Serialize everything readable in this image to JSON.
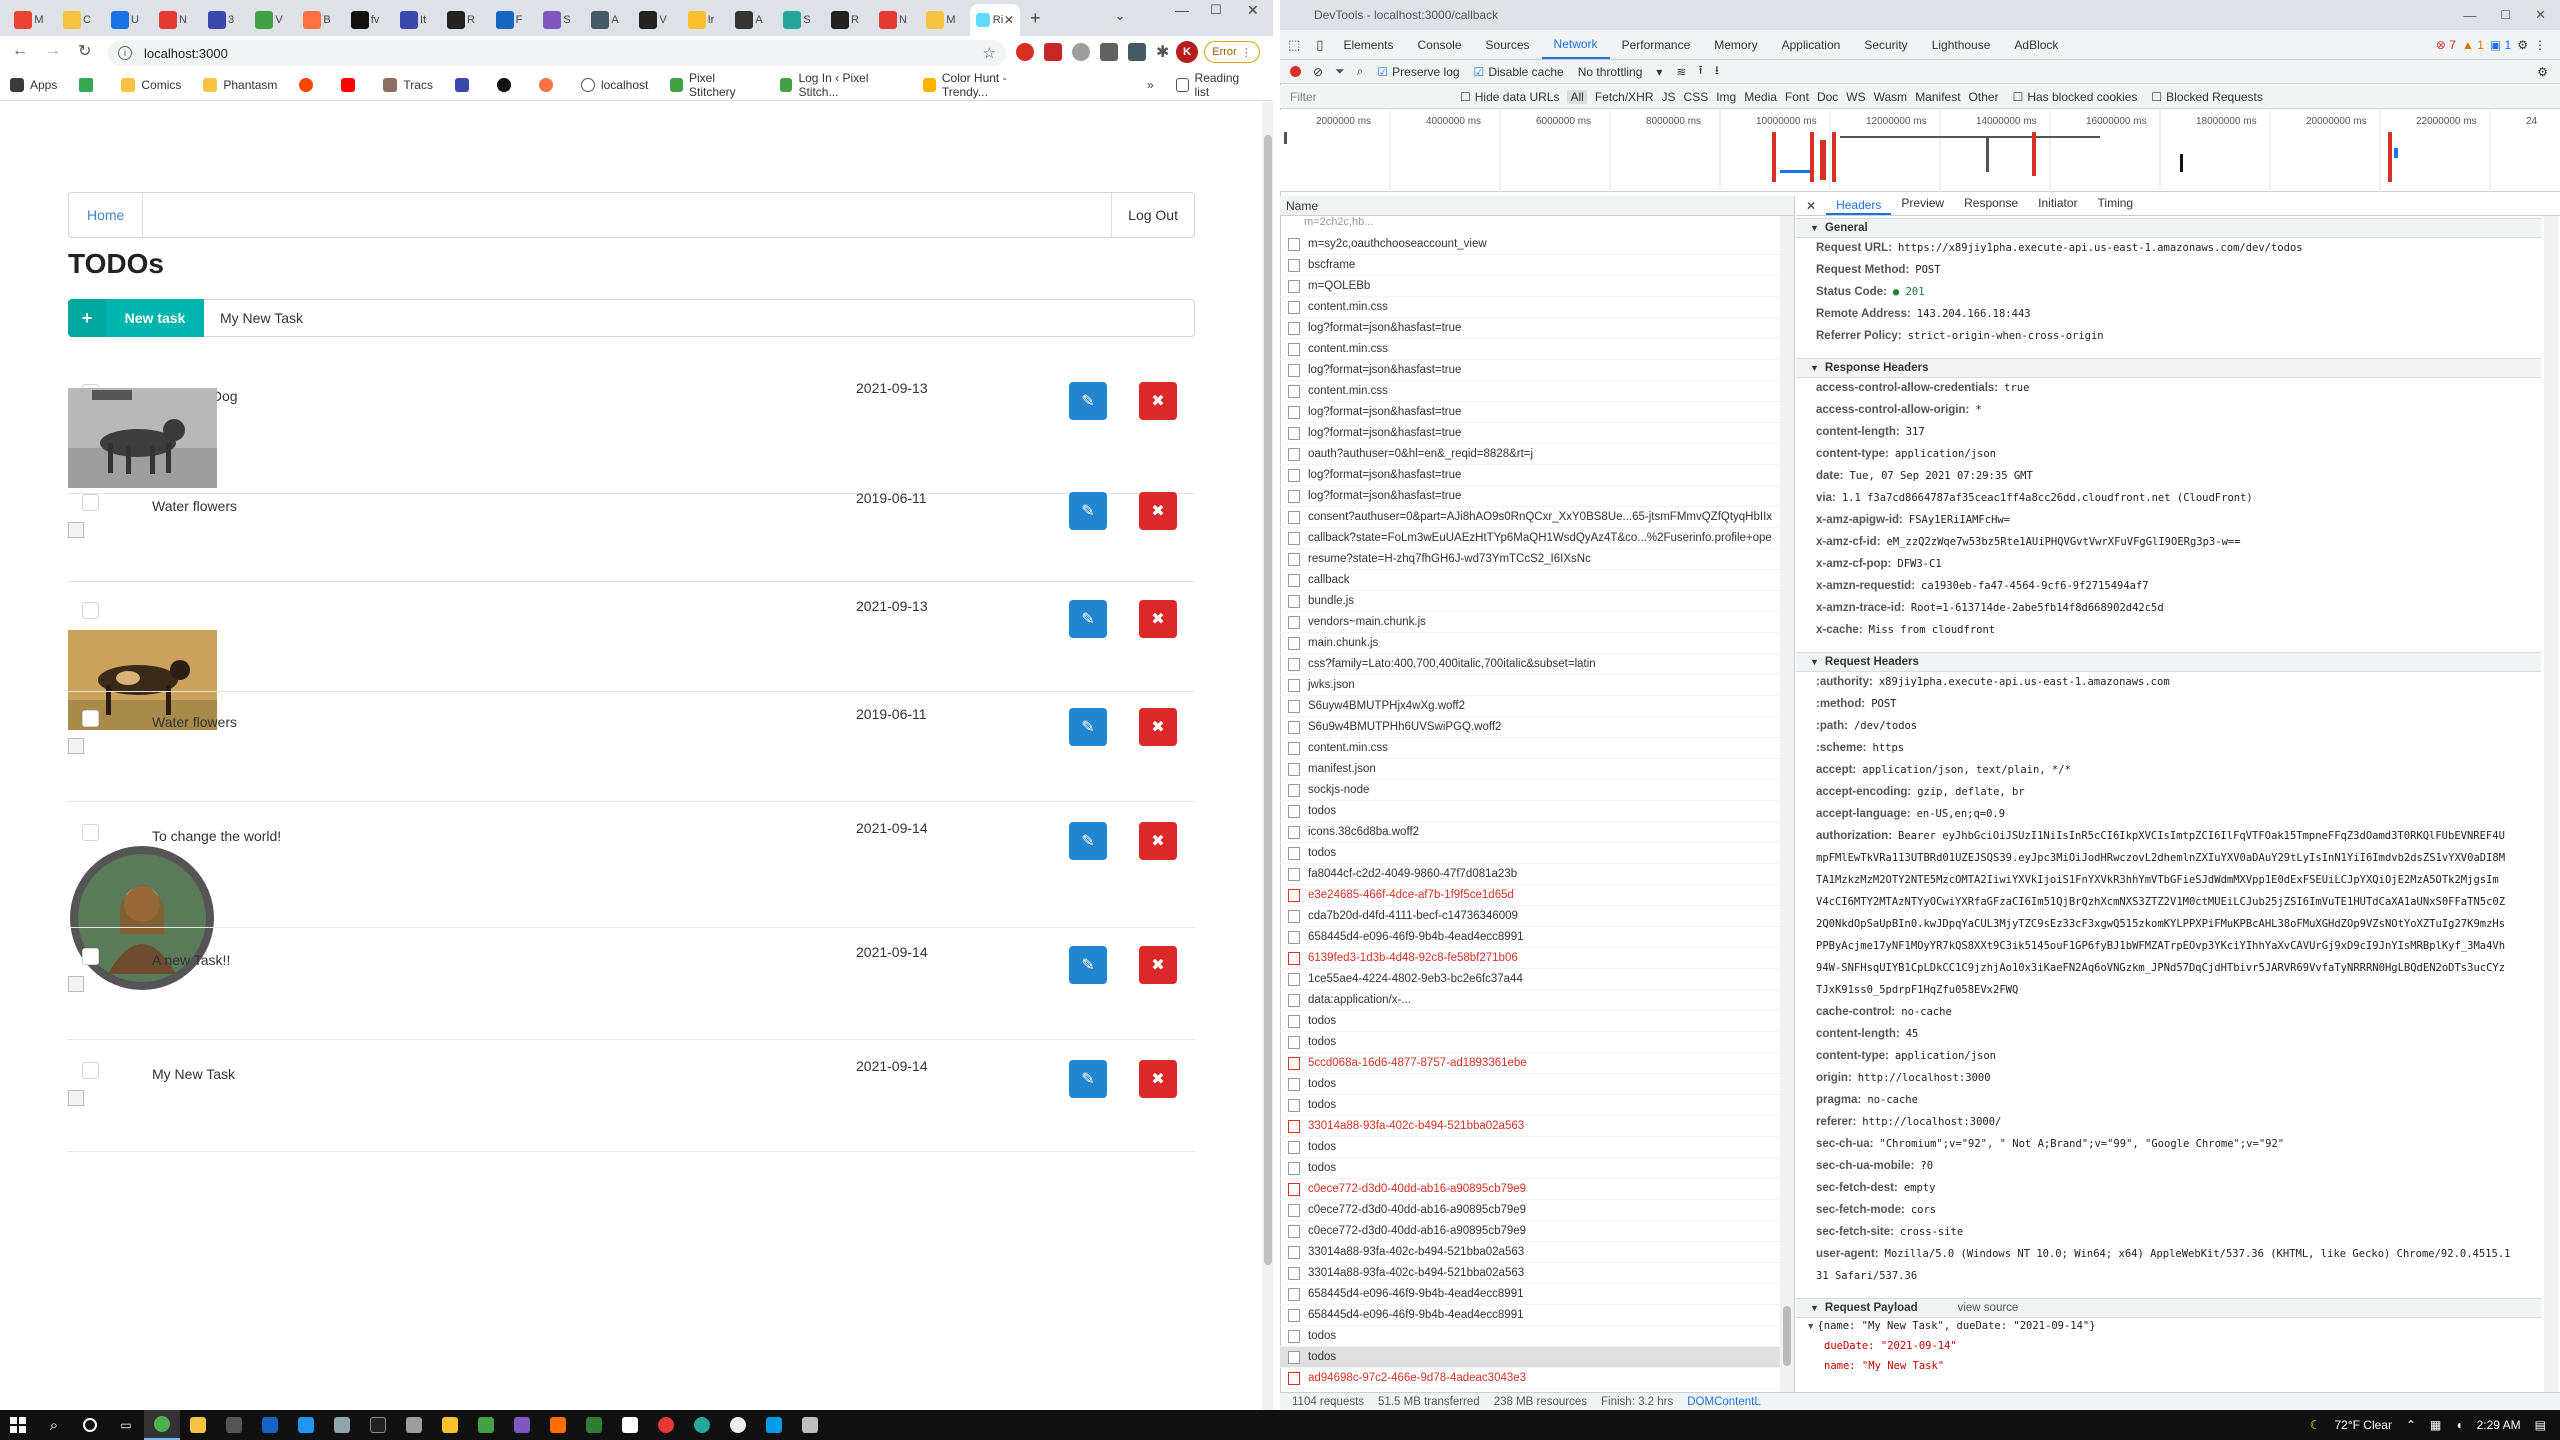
{
  "colors": {
    "accent": "#1a73e8",
    "teal": "#00b5ad",
    "blue": "#2185d0",
    "red": "#db2828",
    "link": "#4183c4"
  },
  "browser": {
    "tabs": [
      "M",
      "C",
      "U",
      "N",
      "3",
      "V",
      "B",
      "fv",
      "It",
      "R",
      "F",
      "S",
      "A",
      "V",
      "Ir",
      "A",
      "S",
      "R",
      "N",
      "M",
      "Ri"
    ],
    "url": "localhost:3000",
    "profile": "K",
    "error_chip": "Error",
    "bookmarks": [
      "Apps",
      "Comics",
      "Phantasm",
      "Tracs",
      "localhost",
      "Pixel Stitchery",
      "Log In ‹ Pixel Stitch...",
      "Color Hunt - Trendy..."
    ],
    "reading_list": "Reading list"
  },
  "app": {
    "nav_home": "Home",
    "nav_logout": "Log Out",
    "title": "TODOs",
    "new_task_label": "New task",
    "new_task_value": "My New Task",
    "todos": [
      {
        "name": "Play with Dog",
        "date": "2021-09-13",
        "done": true,
        "image": "wolf"
      },
      {
        "name": "Water flowers",
        "date": "2019-06-11",
        "done": false,
        "image": "broken"
      },
      {
        "name": "",
        "date": "2021-09-13",
        "done": false,
        "image": "wild-dog"
      },
      {
        "name": "Water flowers",
        "date": "2019-06-11",
        "done": false,
        "image": "broken"
      },
      {
        "name": "To change the world!",
        "date": "2021-09-14",
        "done": false,
        "image": "portrait"
      },
      {
        "name": "A new Task!!",
        "date": "2021-09-14",
        "done": false,
        "image": "broken"
      },
      {
        "name": "My New Task",
        "date": "2021-09-14",
        "done": false,
        "image": "broken"
      }
    ]
  },
  "devtools": {
    "title": "DevTools - localhost:3000/callback",
    "panels": [
      "Elements",
      "Console",
      "Sources",
      "Network",
      "Performance",
      "Memory",
      "Application",
      "Security",
      "Lighthouse",
      "AdBlock"
    ],
    "active_panel": "Network",
    "issues": {
      "errors": "7",
      "warnings": "1",
      "info": "1"
    },
    "preserve_log": "Preserve log",
    "disable_cache": "Disable cache",
    "throttling": "No throttling",
    "filter_placeholder": "Filter",
    "hide_data_urls": "Hide data URLs",
    "type_filters": [
      "All",
      "Fetch/XHR",
      "JS",
      "CSS",
      "Img",
      "Media",
      "Font",
      "Doc",
      "WS",
      "Wasm",
      "Manifest",
      "Other"
    ],
    "has_blocked_cookies": "Has blocked cookies",
    "blocked_requests": "Blocked Requests",
    "timeline_ticks": [
      "2000000 ms",
      "4000000 ms",
      "6000000 ms",
      "8000000 ms",
      "10000000 ms",
      "12000000 ms",
      "14000000 ms",
      "16000000 ms",
      "18000000 ms",
      "20000000 ms",
      "22000000 ms",
      "24"
    ],
    "name_header": "Name",
    "requests": [
      {
        "n": "m=sy2c,oauthchooseaccount_view",
        "e": false
      },
      {
        "n": "bscframe",
        "e": false
      },
      {
        "n": "m=QOLEBb",
        "e": false
      },
      {
        "n": "content.min.css",
        "e": false
      },
      {
        "n": "log?format=json&hasfast=true",
        "e": false
      },
      {
        "n": "content.min.css",
        "e": false
      },
      {
        "n": "log?format=json&hasfast=true",
        "e": false
      },
      {
        "n": "content.min.css",
        "e": false
      },
      {
        "n": "log?format=json&hasfast=true",
        "e": false
      },
      {
        "n": "log?format=json&hasfast=true",
        "e": false
      },
      {
        "n": "oauth?authuser=0&hl=en&_reqid=8828&rt=j",
        "e": false
      },
      {
        "n": "log?format=json&hasfast=true",
        "e": false
      },
      {
        "n": "log?format=json&hasfast=true",
        "e": false
      },
      {
        "n": "consent?authuser=0&part=AJi8hAO9s0RnQCxr_XxY0BS8Ue...65-jtsmFMmvQZfQtyqHbIIx",
        "e": false
      },
      {
        "n": "callback?state=FoLm3wEuUAEzHtTYp6MaQH1WsdQyAz4T&co...%2Fuserinfo.profile+ope",
        "e": false
      },
      {
        "n": "resume?state=H-zhq7fhGH6J-wd73YmTCcS2_I6IXsNc",
        "e": false
      },
      {
        "n": "callback",
        "e": false
      },
      {
        "n": "bundle.js",
        "e": false
      },
      {
        "n": "vendors~main.chunk.js",
        "e": false
      },
      {
        "n": "main.chunk.js",
        "e": false
      },
      {
        "n": "css?family=Lato:400,700,400italic,700italic&subset=latin",
        "e": false
      },
      {
        "n": "jwks.json",
        "e": false
      },
      {
        "n": "S6uyw4BMUTPHjx4wXg.woff2",
        "e": false
      },
      {
        "n": "S6u9w4BMUTPHh6UVSwiPGQ.woff2",
        "e": false
      },
      {
        "n": "content.min.css",
        "e": false
      },
      {
        "n": "manifest.json",
        "e": false
      },
      {
        "n": "sockjs-node",
        "e": false
      },
      {
        "n": "todos",
        "e": false
      },
      {
        "n": "icons.38c6d8ba.woff2",
        "e": false
      },
      {
        "n": "todos",
        "e": false
      },
      {
        "n": "fa8044cf-c2d2-4049-9860-47f7d081a23b",
        "e": false
      },
      {
        "n": "e3e24685-466f-4dce-af7b-1f9f5ce1d65d",
        "e": true
      },
      {
        "n": "cda7b20d-d4fd-4111-becf-c14736346009",
        "e": false
      },
      {
        "n": "658445d4-e096-46f9-9b4b-4ead4ecc8991",
        "e": false
      },
      {
        "n": "6139fed3-1d3b-4d48-92c8-fe58bf271b06",
        "e": true
      },
      {
        "n": "1ce55ae4-4224-4802-9eb3-bc2e6fc37a44",
        "e": false
      },
      {
        "n": "data:application/x-...",
        "e": false
      },
      {
        "n": "todos",
        "e": false
      },
      {
        "n": "todos",
        "e": false
      },
      {
        "n": "5ccd068a-16d6-4877-8757-ad1893361ebe",
        "e": true
      },
      {
        "n": "todos",
        "e": false
      },
      {
        "n": "todos",
        "e": false
      },
      {
        "n": "33014a88-93fa-402c-b494-521bba02a563",
        "e": true
      },
      {
        "n": "todos",
        "e": false
      },
      {
        "n": "todos",
        "e": false
      },
      {
        "n": "c0ece772-d3d0-40dd-ab16-a90895cb79e9",
        "e": true
      },
      {
        "n": "c0ece772-d3d0-40dd-ab16-a90895cb79e9",
        "e": false
      },
      {
        "n": "c0ece772-d3d0-40dd-ab16-a90895cb79e9",
        "e": false
      },
      {
        "n": "33014a88-93fa-402c-b494-521bba02a563",
        "e": false
      },
      {
        "n": "33014a88-93fa-402c-b494-521bba02a563",
        "e": false
      },
      {
        "n": "658445d4-e096-46f9-9b4b-4ead4ecc8991",
        "e": false
      },
      {
        "n": "658445d4-e096-46f9-9b4b-4ead4ecc8991",
        "e": false
      },
      {
        "n": "todos",
        "e": false
      },
      {
        "n": "todos",
        "e": false,
        "sel": true
      },
      {
        "n": "ad94698c-97c2-466e-9d78-4adeac3043e3",
        "e": true
      }
    ],
    "detail_tabs": [
      "Headers",
      "Preview",
      "Response",
      "Initiator",
      "Timing"
    ],
    "general_title": "General",
    "general": [
      [
        "Request URL:",
        "https://x89jiy1pha.execute-api.us-east-1.amazonaws.com/dev/todos"
      ],
      [
        "Request Method:",
        "POST"
      ],
      [
        "Status Code:",
        "● 201"
      ],
      [
        "Remote Address:",
        "143.204.166.18:443"
      ],
      [
        "Referrer Policy:",
        "strict-origin-when-cross-origin"
      ]
    ],
    "resp_title": "Response Headers",
    "resp": [
      [
        "access-control-allow-credentials:",
        "true"
      ],
      [
        "access-control-allow-origin:",
        "*"
      ],
      [
        "content-length:",
        "317"
      ],
      [
        "content-type:",
        "application/json"
      ],
      [
        "date:",
        "Tue, 07 Sep 2021 07:29:35 GMT"
      ],
      [
        "via:",
        "1.1 f3a7cd8664787af35ceac1ff4a8cc26dd.cloudfront.net (CloudFront)"
      ],
      [
        "x-amz-apigw-id:",
        "FSAy1ERiIAMFcHw="
      ],
      [
        "x-amz-cf-id:",
        "eM_zzQ2zWqe7w53bz5Rte1AUiPHQVGvtVwrXFuVFgGlI9OERg3p3-w=="
      ],
      [
        "x-amz-cf-pop:",
        "DFW3-C1"
      ],
      [
        "x-amzn-requestid:",
        "ca1930eb-fa47-4564-9cf6-9f2715494af7"
      ],
      [
        "x-amzn-trace-id:",
        "Root=1-613714de-2abe5fb14f8d668902d42c5d"
      ],
      [
        "x-cache:",
        "Miss from cloudfront"
      ]
    ],
    "req_title": "Request Headers",
    "reqh": [
      [
        ":authority:",
        "x89jiy1pha.execute-api.us-east-1.amazonaws.com"
      ],
      [
        ":method:",
        "POST"
      ],
      [
        ":path:",
        "/dev/todos"
      ],
      [
        ":scheme:",
        "https"
      ],
      [
        "accept:",
        "application/json, text/plain, */*"
      ],
      [
        "accept-encoding:",
        "gzip, deflate, br"
      ],
      [
        "accept-language:",
        "en-US,en;q=0.9"
      ],
      [
        "authorization:",
        "Bearer eyJhbGciOiJSUzI1NiIsInR5cCI6IkpXVCIsImtpZCI6IlFqVTFOak15TmpneFFqZ3dOamd3T0RKQlFUbEVNREF4U"
      ],
      [
        "",
        "mpFMlEwTkVRa113UTBRd01UZEJSQS39.eyJpc3MiOiJodHRwczovL2dhemlnZXIuYXV0aDAuY29tLyIsInN1YiI6Imdvb2dsZS1vYXV0aDI8M"
      ],
      [
        "",
        "TA1MzkzMzM2OTY2NTE5MzcOMTA2IiwiYXVkIjoiS1FnYXVkR3hhYmVTbGFieSJdWdmMXVpp1E0dExFSEUiLCJpYXQiOjE2MzA5OTk2MjgsIm"
      ],
      [
        "",
        "V4cCI6MTY2MTAzNTYyOCwiYXRfaGFzaCI6Im51QjBrQzhXcmNXS3ZTZ2V1M0ctMUEiLCJub25jZSI6ImVuTE1HUTdCaXA1aUNxS0FFaTN5c0Z"
      ],
      [
        "",
        "2Q0NkdOpSaUpBIn0.kwJDpqYaCUL3MjyTZC9sEz33cF3xgwQ515zkomKYLPPXPiFMuKPBcAHL38oFMuXGHdZOp9VZsNOtYoXZTuIg27K9mzHs"
      ],
      [
        "",
        "PPByAcjme17yNF1MOyYR7kQS8XXt9C3ik5145ouF1GP6fyBJ1bWFMZATrpEOvp3YKciYIhhYaXvCAVUrGj9xD9cI9JnYIsMRBplKyf_3Ma4Vh"
      ],
      [
        "",
        "94W-SNFHsqUIYB1CpLDkCC1C9jzhjAo10x3iKaeFN2Aq6oVNGzkm_JPNd57DqCjdHTbivr5JARVR69VvfaTyNRRRN0HgLBQdEN2oDTs3ucCYz"
      ],
      [
        "",
        "TJxK91ss0_5pdrpF1HqZfu058EVx2FWQ"
      ],
      [
        "cache-control:",
        "no-cache"
      ],
      [
        "content-length:",
        "45"
      ],
      [
        "content-type:",
        "application/json"
      ],
      [
        "origin:",
        "http://localhost:3000"
      ],
      [
        "pragma:",
        "no-cache"
      ],
      [
        "referer:",
        "http://localhost:3000/"
      ],
      [
        "sec-ch-ua:",
        "\"Chromium\";v=\"92\", \" Not A;Brand\";v=\"99\", \"Google Chrome\";v=\"92\""
      ],
      [
        "sec-ch-ua-mobile:",
        "?0"
      ],
      [
        "sec-fetch-dest:",
        "empty"
      ],
      [
        "sec-fetch-mode:",
        "cors"
      ],
      [
        "sec-fetch-site:",
        "cross-site"
      ],
      [
        "user-agent:",
        "Mozilla/5.0 (Windows NT 10.0; Win64; x64) AppleWebKit/537.36 (KHTML, like Gecko) Chrome/92.0.4515.1"
      ],
      [
        "",
        "31 Safari/537.36"
      ]
    ],
    "payload_title": "Request Payload",
    "view_source": "view source",
    "payload_line": "{name: \"My New Task\", dueDate: \"2021-09-14\"}",
    "payload_due": "dueDate: \"2021-09-14\"",
    "payload_name": "name: \"My New Task\"",
    "status": {
      "requests": "1104 requests",
      "transferred": "51.5 MB transferred",
      "resources": "238 MB resources",
      "finish": "Finish: 3.2 hrs",
      "dcl": "DOMContentL"
    }
  },
  "taskbar": {
    "weather": "72°F  Clear",
    "time": "2:29 AM"
  }
}
